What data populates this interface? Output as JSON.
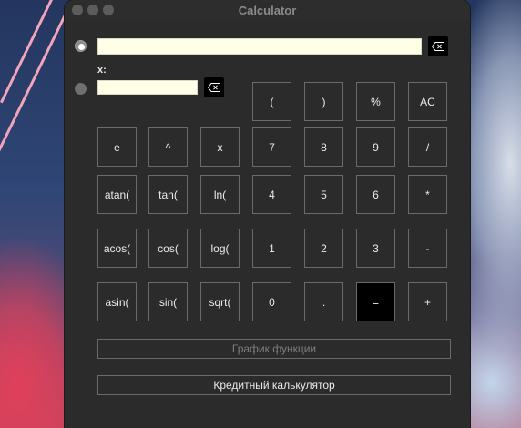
{
  "window": {
    "title": "Calculator"
  },
  "x_label": "x:",
  "keys": {
    "lparen": "(",
    "rparen": ")",
    "percent": "%",
    "clear": "AC",
    "e": "e",
    "pow": "^",
    "x": "x",
    "d7": "7",
    "d8": "8",
    "d9": "9",
    "div": "/",
    "atan": "atan(",
    "tan": "tan(",
    "ln": "ln(",
    "d4": "4",
    "d5": "5",
    "d6": "6",
    "mul": "*",
    "acos": "acos(",
    "cos": "cos(",
    "log": "log(",
    "d1": "1",
    "d2": "2",
    "d3": "3",
    "minus": "-",
    "asin": "asin(",
    "sin": "sin(",
    "sqrt": "sqrt(",
    "d0": "0",
    "dot": ".",
    "eq": "=",
    "plus": "+"
  },
  "buttons": {
    "graph": "График функции",
    "credit": "Кредитный калькулятор"
  },
  "inputs": {
    "expression": "",
    "x_value": ""
  },
  "icons": {
    "backspace": "backspace-icon"
  }
}
